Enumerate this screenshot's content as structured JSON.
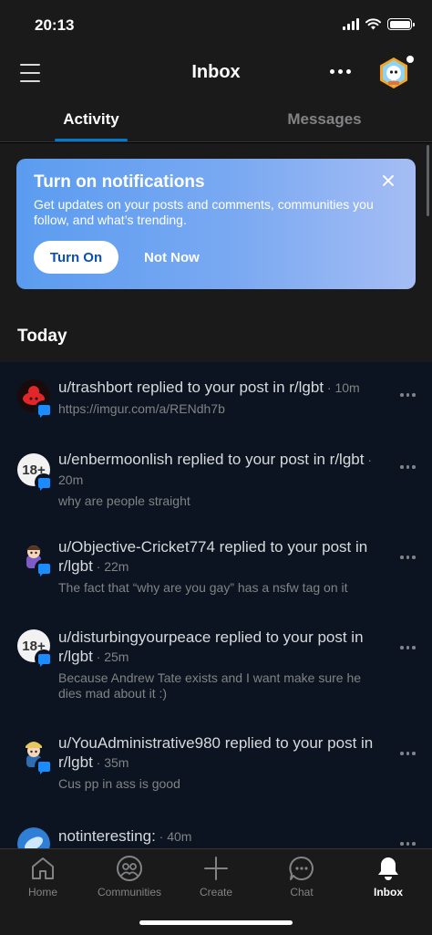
{
  "status_bar": {
    "time": "20:13"
  },
  "header": {
    "title": "Inbox"
  },
  "tabs": {
    "activity": "Activity",
    "messages": "Messages"
  },
  "banner": {
    "title": "Turn on notifications",
    "description": "Get updates on your posts and comments, communities you follow, and what’s trending.",
    "turn_on": "Turn On",
    "not_now": "Not Now"
  },
  "section": {
    "title": "Today"
  },
  "notifications": [
    {
      "head": "u/trashbort replied to your post in r/lgbt",
      "time": " · 10m",
      "sub": "https://imgur.com/a/RENdh7b",
      "avatar": "nsfw"
    },
    {
      "head": "u/enbermoonlish replied to your post in r/lgbt",
      "time": " · 20m",
      "sub": "why are people straight",
      "avatar_text": "18+"
    },
    {
      "head": "u/Objective-Cricket774 replied to your post in r/lgbt",
      "time": " · 22m",
      "sub": "The fact that “why are you gay” has a nsfw tag on it"
    },
    {
      "head": "u/disturbingyourpeace replied to your post in r/lgbt",
      "time": " · 25m",
      "sub": "Because Andrew Tate exists and I want make sure he dies mad about it :)",
      "avatar_text": "18+"
    },
    {
      "head": "u/YouAdministrative980 replied to your post in r/lgbt",
      "time": " · 35m",
      "sub": "Cus pp in ass is good"
    },
    {
      "head": "notinteresting:",
      "time": " · 40m",
      "sub": ""
    }
  ],
  "bottom_nav": {
    "home": "Home",
    "communities": "Communities",
    "create": "Create",
    "chat": "Chat",
    "inbox": "Inbox"
  },
  "colors": {
    "accent": "#0079d3",
    "banner_start": "#5b9cf0",
    "banner_end": "#a5bdf4",
    "feed_background": "#0b1420",
    "badge": "#1a8cff"
  },
  "icons": [
    "menu-icon",
    "more-icon",
    "user-avatar",
    "close-icon",
    "comment-badge-icon",
    "home-icon",
    "communities-icon",
    "create-icon",
    "chat-icon",
    "inbox-bell-icon"
  ]
}
